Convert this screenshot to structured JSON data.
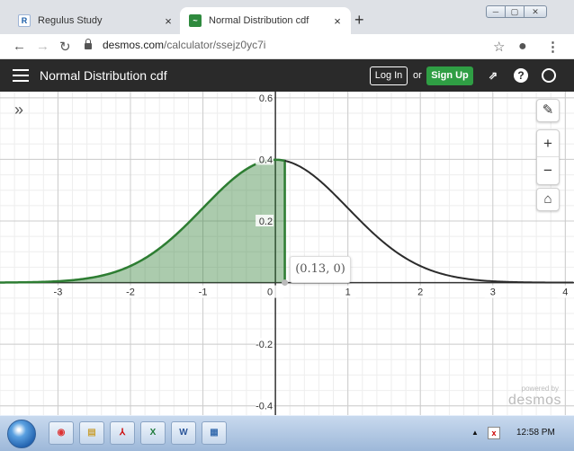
{
  "browser": {
    "tabs": [
      {
        "favicon": "R",
        "title": "Regulus Study",
        "close": "×"
      },
      {
        "favicon": "desmos-icon",
        "title": "Normal Distribution cdf",
        "close": "×"
      }
    ],
    "new_tab": "+",
    "url_domain": "desmos.com",
    "url_path": "/calculator/ssejz0yc7i",
    "window_controls": [
      "─",
      "▢",
      "✕"
    ]
  },
  "header": {
    "title": "Normal Distribution cdf",
    "login_label": "Log In",
    "or_label": "or",
    "signup_label": "Sign Up",
    "help_label": "?"
  },
  "graph": {
    "point_label": "(0.13, 0)",
    "powered_by": "powered by",
    "brand": "desmos",
    "zoom_in": "+",
    "zoom_out": "−",
    "curve_color": "#2b2b2b",
    "shade_color": "#2d7d32",
    "shade_upper": 0.13
  },
  "chart_data": {
    "type": "line",
    "function": "normal pdf, mean 0, sd 1",
    "shaded_to_x": 0.13,
    "highlight_point": [
      0.13,
      0
    ],
    "xlim": [
      -3.8,
      4.12
    ],
    "ylim": [
      -0.43,
      0.62
    ],
    "x_ticks": [
      -3,
      -2,
      -1,
      0,
      1,
      2,
      3,
      4
    ],
    "y_ticks": [
      -0.4,
      -0.2,
      0.2,
      0.4,
      0.6
    ],
    "x_tick_labels": [
      "-3",
      "-2",
      "-1",
      "0",
      "1",
      "2",
      "3",
      "4"
    ],
    "y_tick_labels": [
      "-0.4",
      "-0.2",
      "0.2",
      "0.4",
      "0.6"
    ],
    "grid": true
  },
  "taskbar": {
    "apps": [
      "chrome-icon",
      "explorer-icon",
      "acrobat-icon",
      "excel-icon",
      "word-icon",
      "paint-icon"
    ],
    "clock": "12:58 PM"
  }
}
